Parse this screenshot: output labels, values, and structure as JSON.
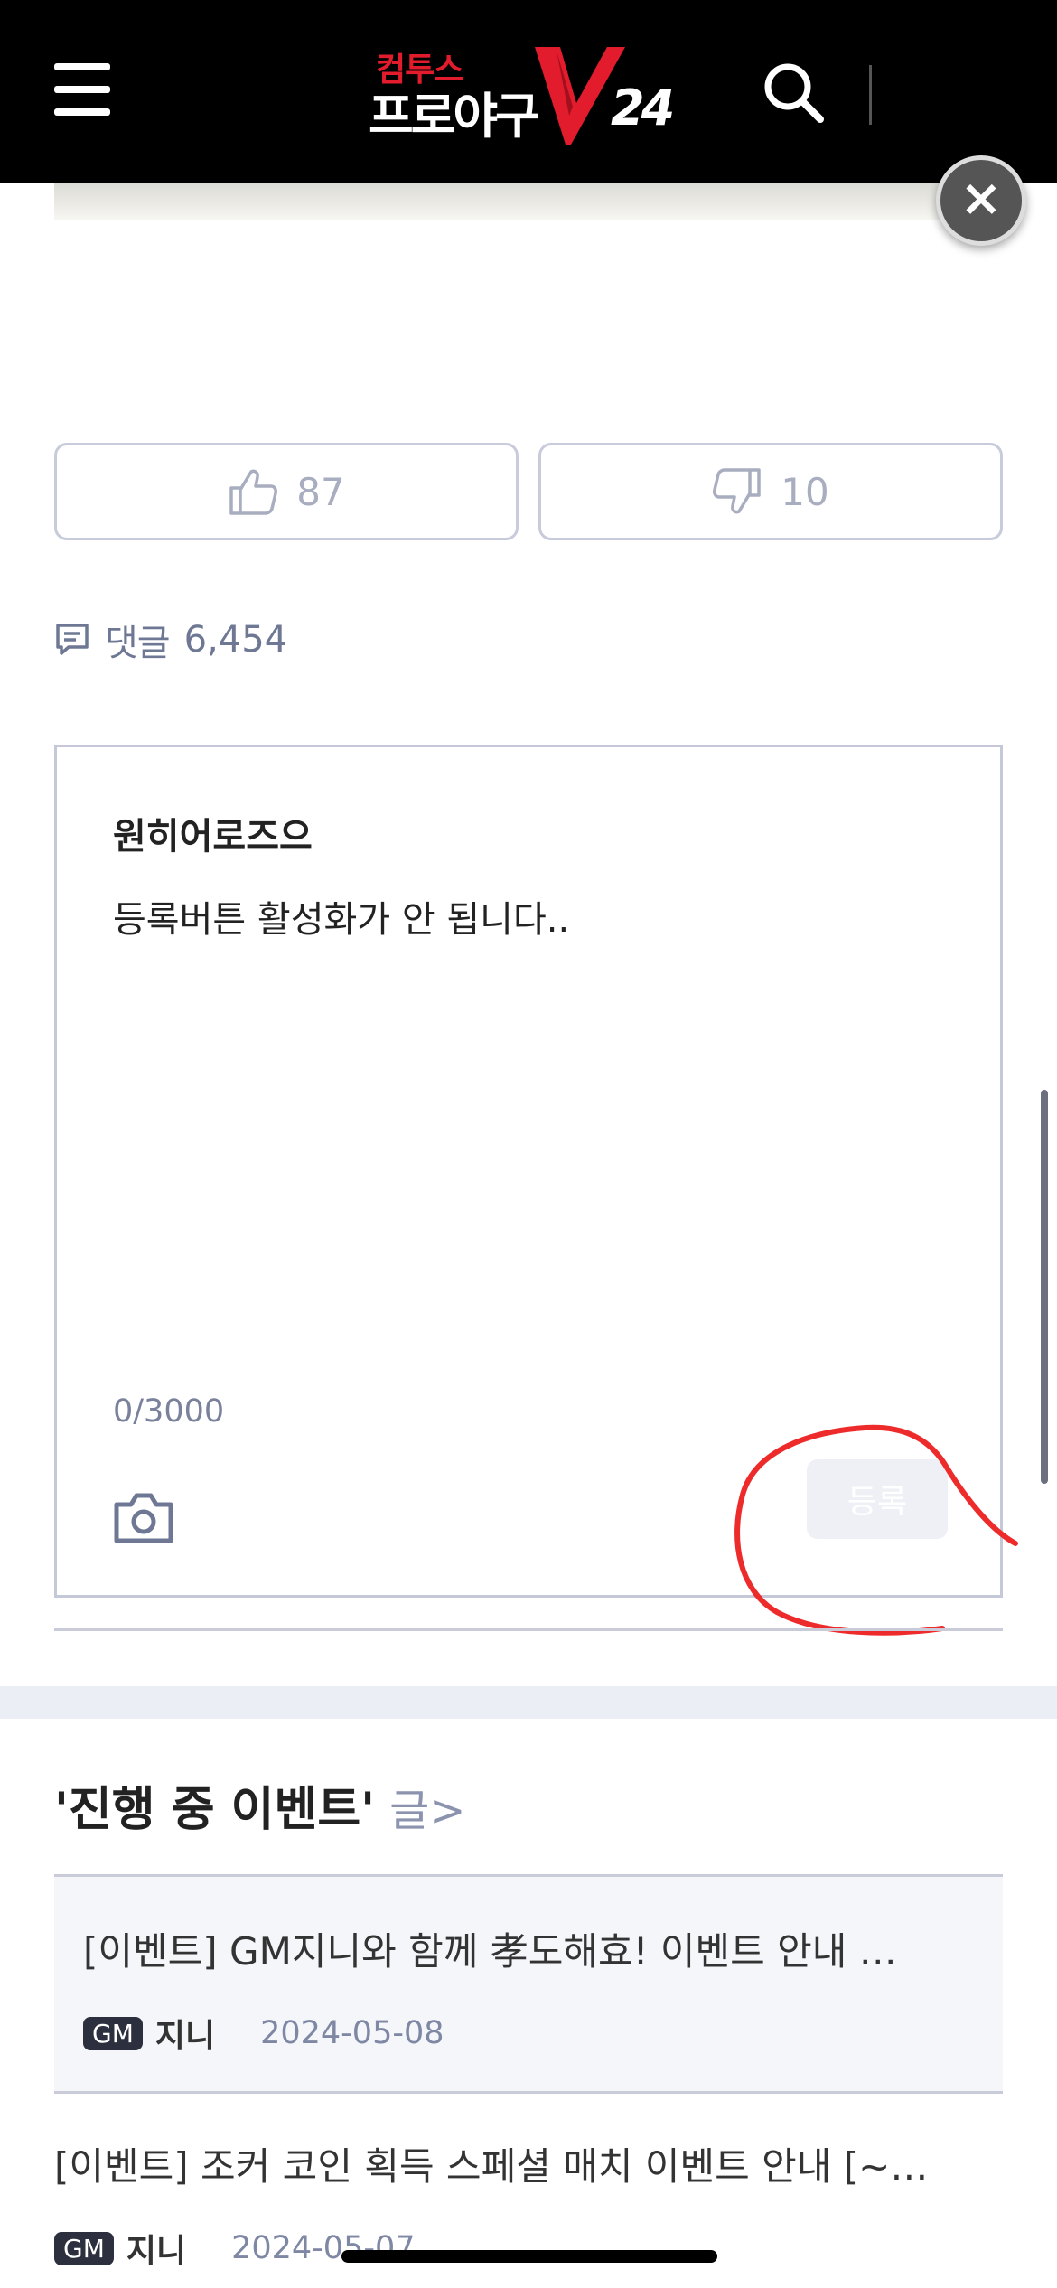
{
  "header": {
    "logo_top": "컴투스",
    "logo_main": "프로야구",
    "logo_num": "24"
  },
  "vote": {
    "likes": "87",
    "dislikes": "10"
  },
  "comments": {
    "label": "댓글",
    "count": "6,454"
  },
  "comment_box": {
    "username": "원히어로즈으",
    "text": "등록버튼 활성화가 안 됩니다..",
    "char_count": "0/3000",
    "submit_label": "등록"
  },
  "events": {
    "title": "'진행 중 이벤트'",
    "more": "글>",
    "items": [
      {
        "title": "[이벤트] GM지니와 함께 孝도해효! 이벤트 안내 …",
        "badge": "GM",
        "author": "지니",
        "date": "2024-05-08"
      },
      {
        "title": "[이벤트] 조커 코인 획득 스페셜 매치 이벤트 안내 [~…",
        "badge": "GM",
        "author": "지니",
        "date": "2024-05-07"
      }
    ]
  },
  "colors": {
    "header_bg": "#000000",
    "brand_red": "#e21c2d",
    "annotation_red": "#ee2b2b"
  },
  "icons": [
    "menu-icon",
    "search-icon",
    "close-icon",
    "thumbs-up-icon",
    "thumbs-down-icon",
    "comment-icon",
    "camera-icon"
  ]
}
